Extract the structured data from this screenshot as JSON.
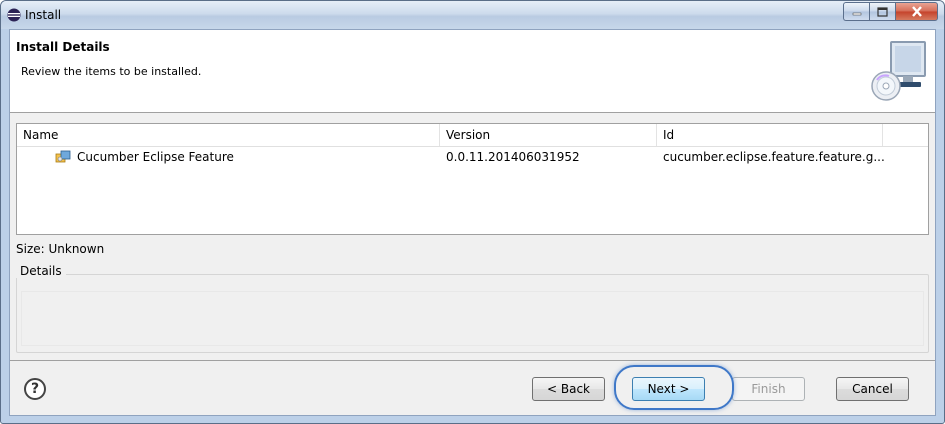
{
  "window": {
    "title": "Install"
  },
  "header": {
    "title": "Install Details",
    "description": "Review the items to be installed."
  },
  "table": {
    "columns": [
      "Name",
      "Version",
      "Id"
    ],
    "rows": [
      {
        "name": "Cucumber Eclipse Feature",
        "version": "0.0.11.201406031952",
        "id": "cucumber.eclipse.feature.feature.g..."
      }
    ]
  },
  "size_label": "Size: Unknown",
  "details_label": "Details",
  "buttons": {
    "back": "< Back",
    "next": "Next >",
    "finish": "Finish",
    "cancel": "Cancel",
    "help": "?"
  },
  "colors": {
    "accent_highlight": "#3f78c8",
    "titlebar": "#c7d7ea",
    "close": "#c5422b"
  }
}
